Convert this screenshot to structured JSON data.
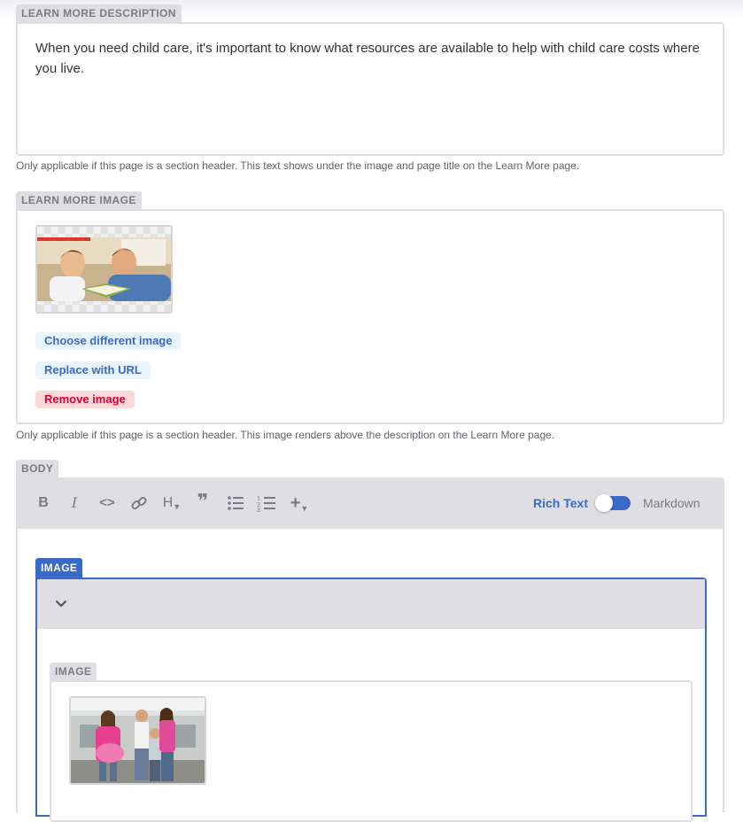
{
  "description": {
    "label": "LEARN MORE DESCRIPTION",
    "value": "When you need child care, it's important to know what resources are available to help with child care costs where you live.",
    "hint": "Only applicable if this page is a section header. This text shows under the image and page title on the Learn More page."
  },
  "image_field": {
    "label": "LEARN MORE IMAGE",
    "choose_label": "Choose different image",
    "url_label": "Replace with URL",
    "remove_label": "Remove image",
    "hint": "Only applicable if this page is a section header. This image renders above the description on the Learn More page."
  },
  "body": {
    "label": "BODY",
    "toolbar": {
      "bold_glyph": "B",
      "italic_glyph": "I",
      "code_glyph": "<>",
      "heading_glyph": "H",
      "quote_glyph": "❞",
      "mode_rich": "Rich Text",
      "mode_markdown": "Markdown",
      "icons": [
        "bold-icon",
        "italic-icon",
        "code-icon",
        "link-icon",
        "heading-icon",
        "quote-icon",
        "bulleted-list-icon",
        "numbered-list-icon",
        "add-component-icon"
      ]
    },
    "component": {
      "label": "IMAGE",
      "inner_label": "IMAGE"
    }
  },
  "colors": {
    "accent": "#3a69c7",
    "danger": "#d60032",
    "label_bg": "#dfdfe3"
  }
}
